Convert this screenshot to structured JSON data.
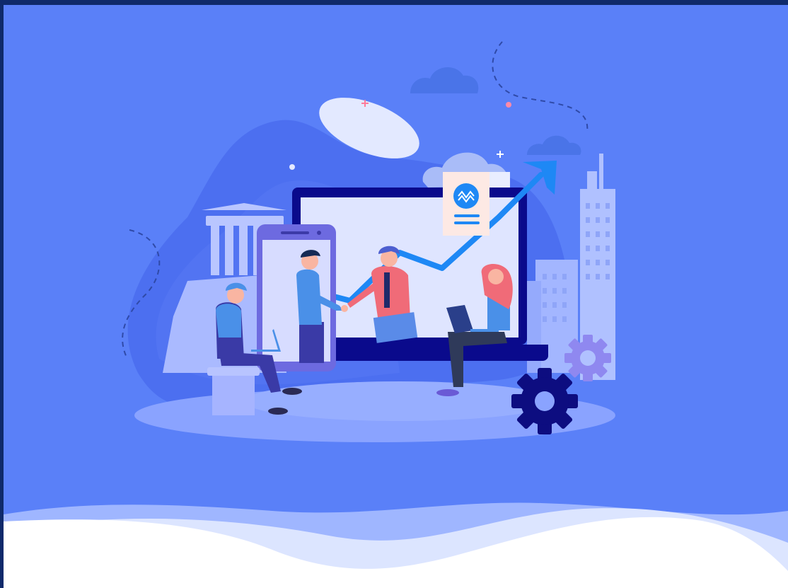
{
  "hero": {
    "illustration": "business-growth-handshake-illustration",
    "colors": {
      "frame": "#0f2a6b",
      "background": "#5a80f8",
      "accent": "#1e88f5",
      "laptop_frame": "#0a0a8c",
      "laptop_screen": "#dfe5ff",
      "wave_white": "#ffffff",
      "wave_light": "#dce5ff",
      "wave_mid": "#9fb6ff"
    },
    "icons": [
      "cloud-icon",
      "cloud-icon",
      "cloud-icon",
      "gear-icon",
      "gear-icon",
      "document-icon",
      "growth-arrow-icon",
      "smartphone-icon",
      "laptop-icon",
      "building-icon",
      "columns-icon"
    ]
  }
}
